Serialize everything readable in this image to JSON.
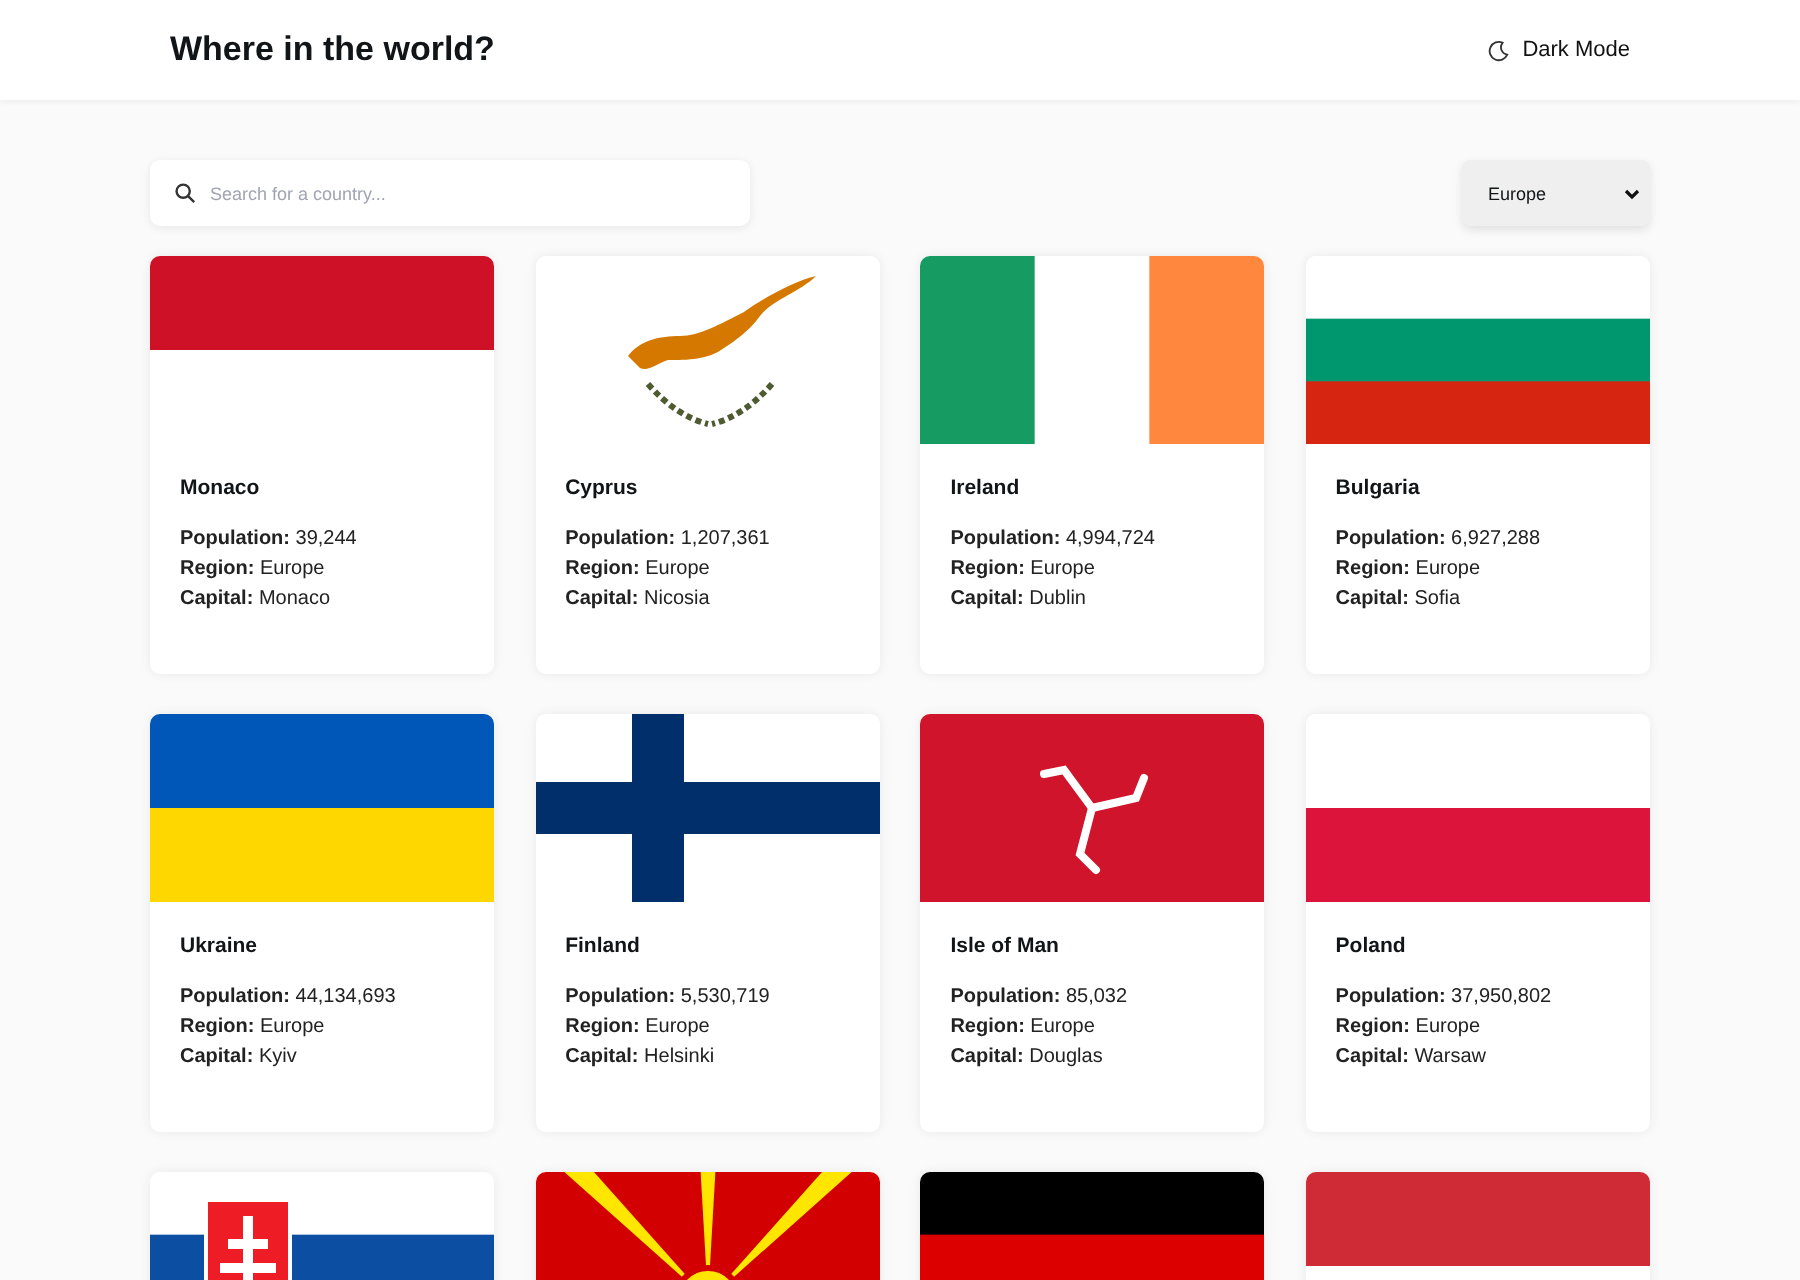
{
  "header": {
    "title": "Where in the world?",
    "theme_toggle": "Dark Mode"
  },
  "search": {
    "placeholder": "Search for a country..."
  },
  "region_filter": {
    "value": "Europe"
  },
  "countries": [
    {
      "name": "Monaco",
      "population": "**Population:** 39,244",
      "region": "**Region:** Europe",
      "capital": "**Capital:** Monaco"
    },
    {
      "name": "Cyprus",
      "population": "**Population:** 1,207,361",
      "region": "**Region:** Europe",
      "capital": "**Capital:** Nicosia"
    },
    {
      "name": "Ireland",
      "population": "**Population:** 4,994,724",
      "region": "**Region:** Europe",
      "capital": "**Capital:** Dublin"
    },
    {
      "name": "Bulgaria",
      "population": "**Population:** 6,927,288",
      "region": "**Region:** Europe",
      "capital": "**Capital:** Sofia"
    },
    {
      "name": "Ukraine",
      "population": "**Population:** 44,134,693",
      "region": "**Region:** Europe",
      "capital": "**Capital:** Kyiv"
    },
    {
      "name": "Finland",
      "population": "**Population:** 5,530,719",
      "region": "**Region:** Europe",
      "capital": "**Capital:** Helsinki"
    },
    {
      "name": "Isle of Man",
      "population": "**Population:** 85,032",
      "region": "**Region:** Europe",
      "capital": "**Capital:** Douglas"
    },
    {
      "name": "Poland",
      "population": "**Population:** 37,950,802",
      "region": "**Region:** Europe",
      "capital": "**Capital:** Warsaw"
    }
  ]
}
